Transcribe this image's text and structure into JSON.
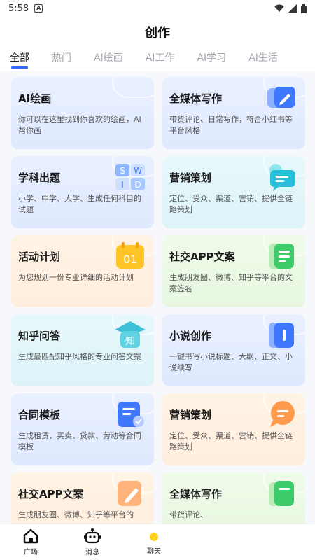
{
  "status": {
    "time": "5:58",
    "badge": "A"
  },
  "header": {
    "title": "创作"
  },
  "tabs": [
    {
      "label": "全部"
    },
    {
      "label": "热门"
    },
    {
      "label": "AI绘画"
    },
    {
      "label": "AI工作"
    },
    {
      "label": "AI学习"
    },
    {
      "label": "AI生活"
    }
  ],
  "cards": [
    {
      "title": "AI绘画",
      "desc": "你可以在这里找到你喜欢的绘画，AI帮你画",
      "icon": "none"
    },
    {
      "title": "全媒体写作",
      "desc": "带货评论、日常写作，符合小红书等平台风格",
      "icon": "pen-icon"
    },
    {
      "title": "学科出题",
      "desc": "小学、中学、大学、生成任何科目的试题",
      "icon": "quiz-blocks-icon",
      "icon_letters": [
        "S",
        "W",
        "I",
        "D"
      ]
    },
    {
      "title": "营销策划",
      "desc": "定位、受众、渠道、营销、提供全链路策划",
      "icon": "chat-bubble-icon"
    },
    {
      "title": "活动计划",
      "desc": "为您规划一份专业详细的活动计划",
      "icon": "calendar-icon",
      "icon_text": "01"
    },
    {
      "title": "社交APP文案",
      "desc": "生成朋友圈、微博、知乎等平台的文案签名",
      "icon": "document-icon"
    },
    {
      "title": "知乎问答",
      "desc": "生成最匹配知乎风格的专业问答文案",
      "icon": "zhihu-icon",
      "icon_text": "知"
    },
    {
      "title": "小说创作",
      "desc": "一键书写小说标题、大纲、正文、小说续写",
      "icon": "book-icon"
    },
    {
      "title": "合同模板",
      "desc": "生成租赁、买卖、贷款、劳动等合同模板",
      "icon": "contract-icon"
    },
    {
      "title": "营销策划",
      "desc": "定位、受众、渠道、营销、提供全链路策划",
      "icon": "orange-bubble-icon"
    },
    {
      "title": "社交APP文案",
      "desc": "生成朋友圈、微博、知乎等平台的",
      "icon": "edit-note-icon"
    },
    {
      "title": "全媒体写作",
      "desc": "带货评论、",
      "icon": "green-doc-icon"
    }
  ],
  "bottom_nav": [
    {
      "label": "广场",
      "icon": "home-icon"
    },
    {
      "label": "消息",
      "icon": "robot-icon"
    },
    {
      "label": "聊天",
      "icon": "dot-icon"
    }
  ]
}
